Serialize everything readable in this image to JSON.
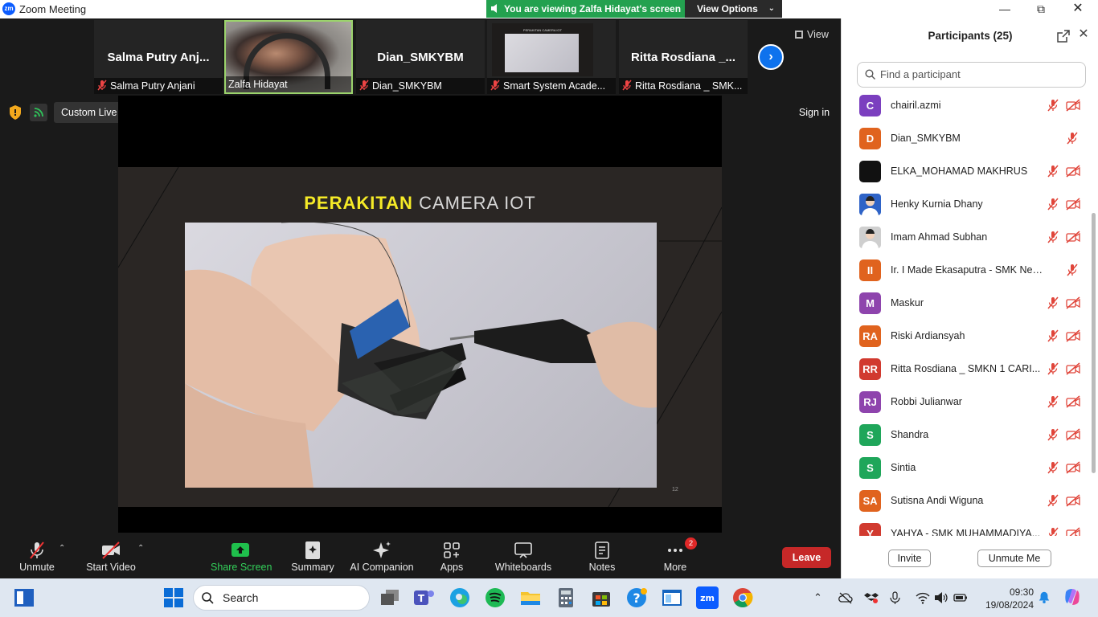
{
  "window": {
    "title": "Zoom Meeting",
    "logo_text": "zm"
  },
  "banner": {
    "text": "You are viewing Zalfa Hidayat's screen",
    "view_options": "View Options"
  },
  "strip": {
    "tiles": [
      {
        "big": "Salma Putry Anj...",
        "label": "Salma Putry Anjani",
        "muted": true
      },
      {
        "big": "",
        "label": "Zalfa Hidayat",
        "muted": false
      },
      {
        "big": "Dian_SMKYBM",
        "label": "Dian_SMKYBM",
        "muted": true
      },
      {
        "big": "",
        "label": "Smart System Acade...",
        "muted": true
      },
      {
        "big": "Ritta Rosdiana _...",
        "label": "Ritta Rosdiana _ SMK...",
        "muted": true
      }
    ],
    "view_label": "View"
  },
  "top_controls": {
    "live_streaming": "Custom Live Streaming Service",
    "sign_in": "Sign in"
  },
  "slide": {
    "title_highlight": "PERAKITAN",
    "title_rest": " CAMERA IOT",
    "page_number": "12",
    "thumb_title": "PERAKITAN CAMERA IOT"
  },
  "toolbar": {
    "unmute": "Unmute",
    "start_video": "Start Video",
    "share_screen": "Share Screen",
    "summary": "Summary",
    "ai_companion": "AI Companion",
    "apps": "Apps",
    "whiteboards": "Whiteboards",
    "notes": "Notes",
    "more": "More",
    "more_badge": "2",
    "leave": "Leave"
  },
  "participants": {
    "header": "Participants (25)",
    "search_placeholder": "Find a participant",
    "list": [
      {
        "initials": "C",
        "name": "chairil.azmi",
        "color": "#7b3fbf",
        "video": true
      },
      {
        "initials": "D",
        "name": "Dian_SMKYBM",
        "color": "#e0631e",
        "video": false
      },
      {
        "initials": "",
        "name": "ELKA_MOHAMAD MAKHRUS",
        "color": "#111111",
        "video": true
      },
      {
        "initials": "",
        "name": "Henky Kurnia Dhany",
        "color": "#2e63c7",
        "video": true
      },
      {
        "initials": "",
        "name": "Imam Ahmad Subhan",
        "color": "#cfcfcf",
        "video": true
      },
      {
        "initials": "II",
        "name": "Ir. I Made Ekasaputra - SMK Neger...",
        "color": "#e0631e",
        "video": false
      },
      {
        "initials": "M",
        "name": "Maskur",
        "color": "#8e44ad",
        "video": true
      },
      {
        "initials": "RA",
        "name": "Riski Ardiansyah",
        "color": "#e0631e",
        "video": true
      },
      {
        "initials": "RR",
        "name": "Ritta Rosdiana _ SMKN 1 CARI...",
        "color": "#d13a2f",
        "video": true
      },
      {
        "initials": "RJ",
        "name": "Robbi Julianwar",
        "color": "#8e44ad",
        "video": true
      },
      {
        "initials": "S",
        "name": "Shandra",
        "color": "#1fa65a",
        "video": true
      },
      {
        "initials": "S",
        "name": "Sintia",
        "color": "#1fa65a",
        "video": true
      },
      {
        "initials": "SA",
        "name": "Sutisna Andi Wiguna",
        "color": "#e0631e",
        "video": true
      },
      {
        "initials": "Y",
        "name": "YAHYA - SMK MUHAMMADIYA...",
        "color": "#d13a2f",
        "video": true
      }
    ],
    "invite": "Invite",
    "unmute_me": "Unmute Me"
  },
  "taskbar": {
    "search": "Search",
    "time": "09:30",
    "date": "19/08/2024"
  }
}
